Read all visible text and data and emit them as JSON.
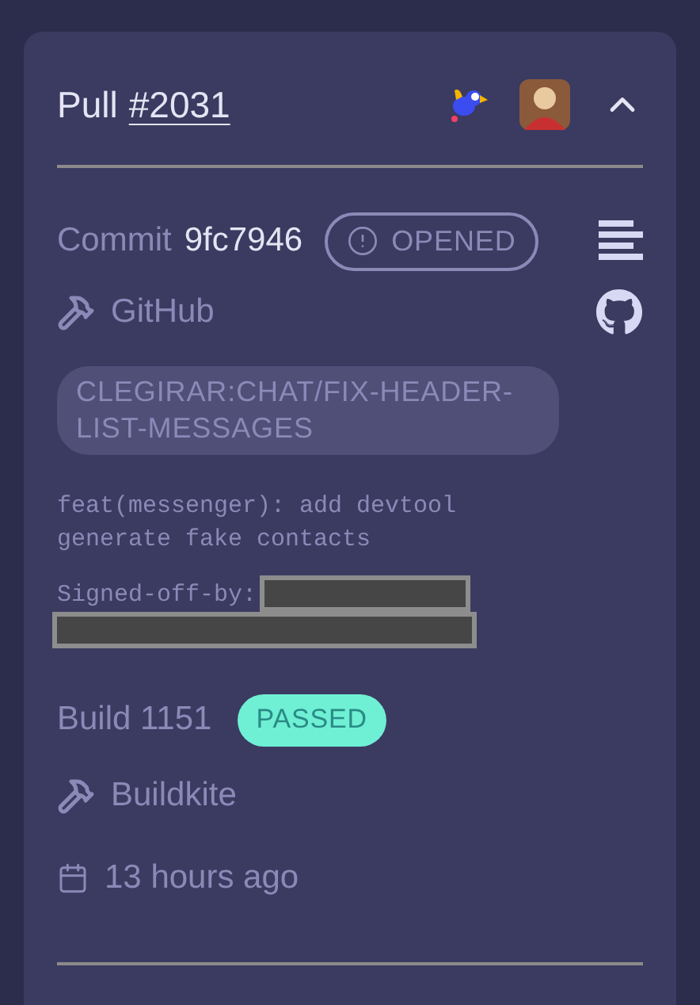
{
  "pull": {
    "label": "Pull",
    "number": "#2031",
    "expanded": true,
    "avatars": [
      {
        "kind": "bird"
      },
      {
        "kind": "person"
      }
    ]
  },
  "commit": {
    "label": "Commit",
    "hash": "9fc7946",
    "status": {
      "kind": "opened",
      "text": "OPENED"
    },
    "source": "GitHub",
    "branch": "CLEGIRAR:CHAT/FIX-HEADER-LIST-MESSAGES",
    "message": [
      "feat(messenger): add devtool",
      "generate fake contacts"
    ],
    "signoff": {
      "label": "Signed-off-by:",
      "redacted": true
    }
  },
  "build": {
    "label": "Build 1151",
    "status": {
      "kind": "passed",
      "text": "PASSED"
    },
    "source": "Buildkite",
    "time": "13 hours ago"
  }
}
